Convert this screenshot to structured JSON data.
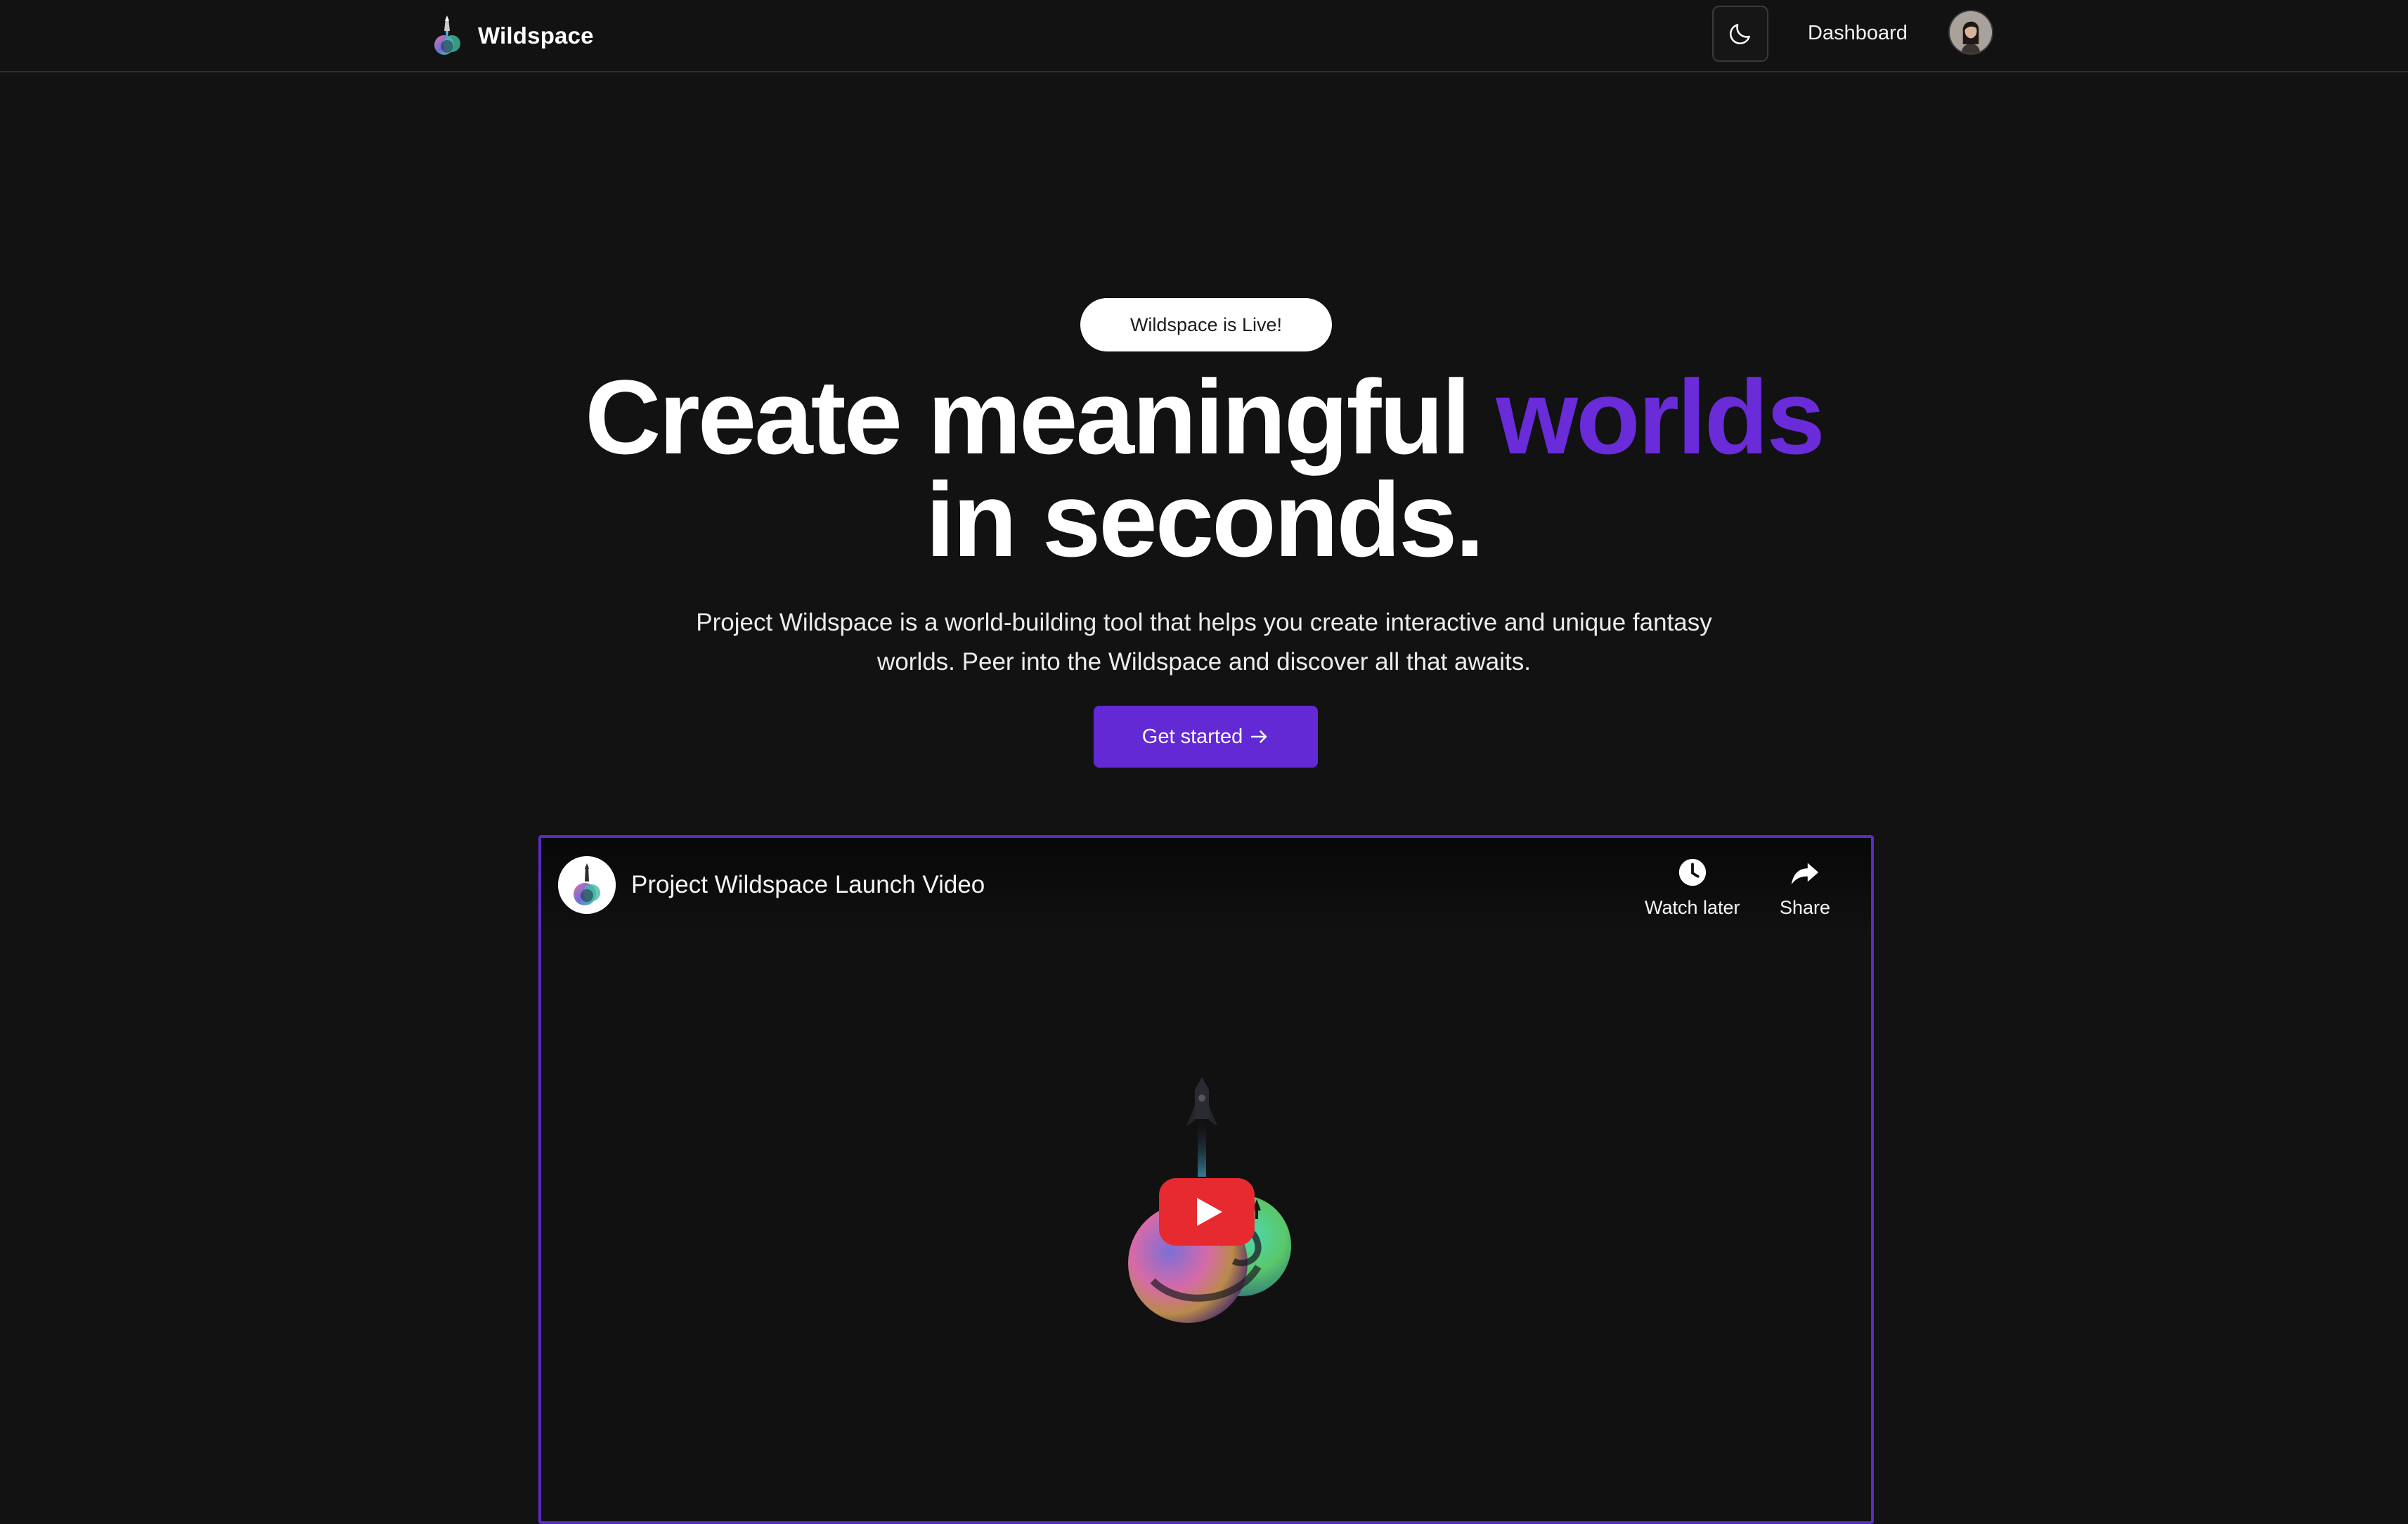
{
  "navbar": {
    "brand_name": "Wildspace",
    "dashboard_label": "Dashboard"
  },
  "hero": {
    "badge": "Wildspace is Live!",
    "headline_part1": "Create meaningful ",
    "headline_accent": "worlds",
    "headline_line2": "in seconds.",
    "description": "Project Wildspace is a world-building tool that helps you create interactive and unique fantasy worlds. Peer into the Wildspace and discover all that awaits.",
    "cta_label": "Get started"
  },
  "video": {
    "title": "Project Wildspace Launch Video",
    "watch_later_label": "Watch later",
    "share_label": "Share"
  },
  "colors": {
    "background": "#121213",
    "accent": "#6a2bd9",
    "cta": "#6229d4",
    "video_border": "#5b2ac4",
    "youtube_red": "#e62a2f"
  },
  "icons": {
    "brand": "wildspace-logo-icon",
    "theme_toggle": "moon-icon",
    "cta_arrow": "arrow-right-icon",
    "watch_later": "clock-icon",
    "share": "share-arrow-icon",
    "play": "youtube-play-icon"
  }
}
